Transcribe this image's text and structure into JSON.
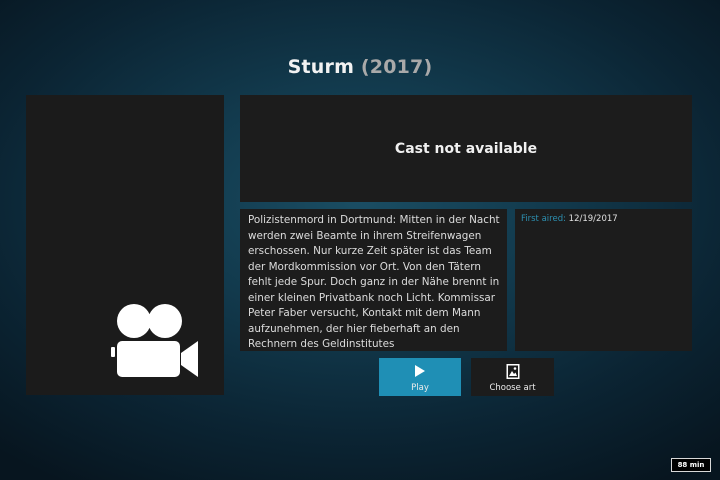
{
  "header": {
    "title": "Sturm",
    "year": "2017",
    "open_paren": "(",
    "close_paren": ")"
  },
  "poster": {
    "placeholder_icon": "video-camera-icon"
  },
  "cast": {
    "message": "Cast not available"
  },
  "plot": {
    "text": "Polizistenmord in Dortmund: Mitten in der Nacht werden zwei Beamte in ihrem Streifenwagen erschossen. Nur kurze Zeit später ist das Team der Mordkommission vor Ort. Von den Tätern fehlt jede Spur. Doch ganz in der Nähe brennt in einer kleinen Privatbank noch Licht. Kommissar Peter Faber versucht, Kontakt mit dem Mann aufzunehmen, der hier fieberhaft an den Rechnern des Geldinstitutes"
  },
  "info": {
    "first_aired_label": "First aired:",
    "first_aired_value": "12/19/2017"
  },
  "buttons": {
    "play": {
      "label": "Play",
      "icon": "play-icon"
    },
    "choose_art": {
      "label": "Choose art",
      "icon": "image-icon"
    }
  },
  "status": {
    "runtime": "88 min"
  },
  "colors": {
    "accent": "#1f8fb5",
    "label_blue": "#2d8fb0",
    "panel": "#1c1c1c"
  }
}
